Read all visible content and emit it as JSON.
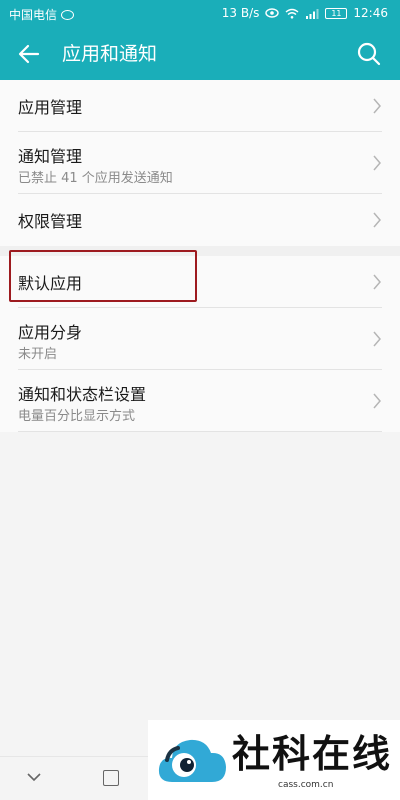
{
  "status": {
    "carrier": "中国电信",
    "speed": "13 B/s",
    "battery": "11",
    "time": "12:46"
  },
  "appbar": {
    "title": "应用和通知",
    "back_icon": "arrow-left-icon",
    "search_icon": "search-icon"
  },
  "list": [
    {
      "title": "应用管理",
      "subtitle": ""
    },
    {
      "title": "通知管理",
      "subtitle": "已禁止 41 个应用发送通知"
    },
    {
      "title": "权限管理",
      "subtitle": ""
    },
    {
      "title": "默认应用",
      "subtitle": ""
    },
    {
      "title": "应用分身",
      "subtitle": "未开启"
    },
    {
      "title": "通知和状态栏设置",
      "subtitle": "电量百分比显示方式"
    }
  ],
  "watermark": {
    "brand": "社科在线",
    "url": "cass.com.cn"
  },
  "colors": {
    "accent": "#1aaeb9",
    "highlight": "#9d1a1f"
  }
}
